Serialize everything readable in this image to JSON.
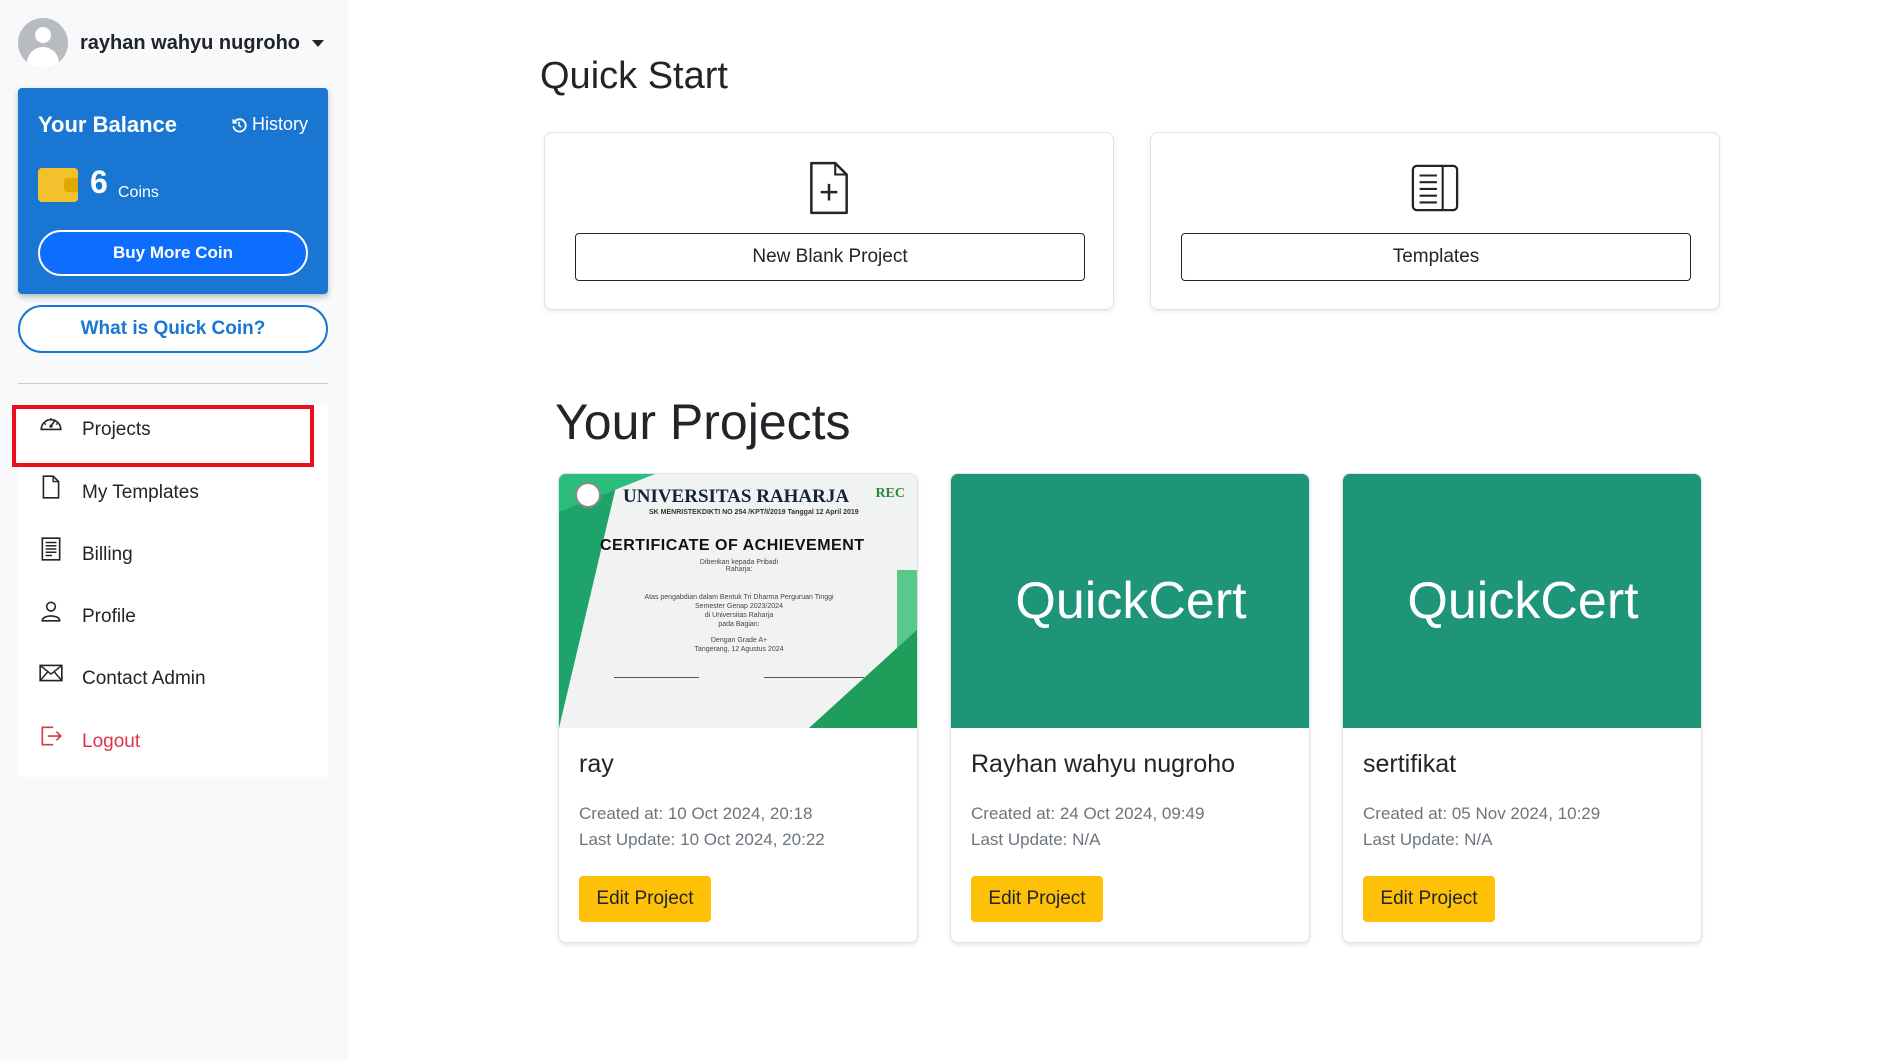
{
  "user": {
    "name": "rayhan wahyu nugroho"
  },
  "balance": {
    "title": "Your Balance",
    "history_label": "History",
    "coins": "6",
    "coins_label": "Coins",
    "buy_label": "Buy More Coin"
  },
  "quick_coin_label": "What is Quick Coin?",
  "nav": {
    "items": [
      {
        "label": "Projects",
        "icon": "speedometer-icon"
      },
      {
        "label": "My Templates",
        "icon": "file-icon"
      },
      {
        "label": "Billing",
        "icon": "receipt-icon"
      },
      {
        "label": "Profile",
        "icon": "person-icon"
      },
      {
        "label": "Contact Admin",
        "icon": "envelope-icon"
      },
      {
        "label": "Logout",
        "icon": "logout-icon"
      }
    ]
  },
  "quick_start": {
    "title": "Quick Start",
    "cards": [
      {
        "label": "New Blank Project",
        "icon": "file-plus-icon"
      },
      {
        "label": "Templates",
        "icon": "document-list-icon"
      }
    ]
  },
  "projects": {
    "title": "Your Projects",
    "edit_label": "Edit Project",
    "items": [
      {
        "name": "ray",
        "created": "Created at: 10 Oct 2024, 20:18",
        "updated": "Last Update: 10 Oct 2024, 20:22",
        "thumb": ""
      },
      {
        "name": "Rayhan wahyu nugroho",
        "created": "Created at: 24 Oct 2024, 09:49",
        "updated": "Last Update: N/A",
        "thumb": "QuickCert"
      },
      {
        "name": "sertifikat",
        "created": "Created at: 05 Nov 2024, 10:29",
        "updated": "Last Update: N/A",
        "thumb": "QuickCert"
      }
    ]
  },
  "certificate": {
    "university": "UNIVERSITAS RAHARJA",
    "decree": "SK MENRISTEKDIKTI NO 254 /KPT/I/2019 Tanggal 12 April 2019",
    "rec": "REC",
    "heading": "CERTIFICATE OF ACHIEVEMENT",
    "given_to": "Diberikan kepada Pribadi Raharja:",
    "body1": "Atas pengabdian dalam Bentuk Tri Dharma Perguruan Tinggi",
    "body2": "Semester Genap 2023/2024",
    "body3": "di Universitas Raharja",
    "body4": "pada Bagian:",
    "grade": "Dengan Grade A+",
    "place_date": "Tangerang, 12 Agustus 2024"
  },
  "colors": {
    "primary": "#1976d2",
    "accent": "#ffc107",
    "thumb": "#1e9579",
    "danger": "#dc3545"
  }
}
